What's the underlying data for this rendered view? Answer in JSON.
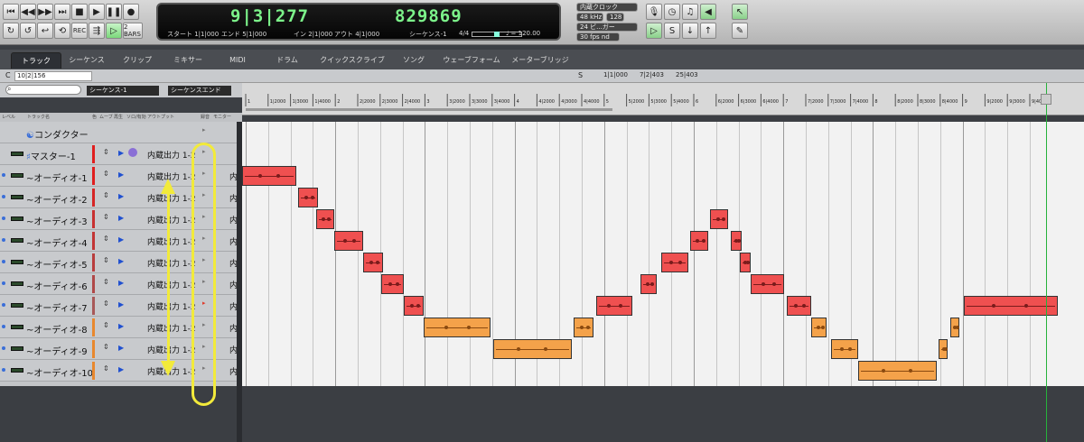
{
  "transport": {
    "buttons": [
      "go-to-start-icon",
      "rewind-icon",
      "fast-forward-icon",
      "go-to-end-icon",
      "stop-icon",
      "play-icon",
      "pause-icon",
      "record-icon"
    ],
    "rec_label": "REC",
    "bars_label": "2 BARS",
    "time_primary": "9|3|277",
    "time_samples": "829869",
    "start_text": "スタート 1|1|000",
    "end_text": "エンド 5|1|000",
    "in_text": "イン 2|1|000",
    "out_text": "アウト 4|1|000",
    "sequence_text": "シーケンス-1",
    "time_sig": "4/4",
    "tempo_text": "♩ = 120.00",
    "clock_source": "内蔵クロック",
    "sample_rate": "48 kHz",
    "buffer": "128",
    "bit_depth": "24 ビ...ガー",
    "fps": "30 fps nd"
  },
  "tabs": [
    {
      "label": "トラック",
      "active": true
    },
    {
      "label": "シーケンス",
      "active": false
    },
    {
      "label": "クリップ",
      "active": false
    },
    {
      "label": "ミキサー",
      "active": false
    },
    {
      "label": "MIDI",
      "active": false
    },
    {
      "label": "ドラム",
      "active": false
    },
    {
      "label": "クイックスクライブ",
      "active": false
    },
    {
      "label": "ソング",
      "active": false
    },
    {
      "label": "ウェーブフォーム",
      "active": false
    },
    {
      "label": "メーターブリッジ",
      "active": false
    }
  ],
  "subheader": {
    "left_label": "C",
    "position": "10|2|156",
    "s_label": "S",
    "range_start": "1|1|000",
    "range_mid": "7|2|403",
    "range_end": "25|403"
  },
  "search": {
    "placeholder": "",
    "sequence_dd": "シーケンス-1",
    "end_dd": "シーケンスエンド"
  },
  "track_columns": [
    "レベル",
    "トラック名",
    "色",
    "ムーブ",
    "再生",
    "ソロ/有効",
    "アウトプット",
    "録音",
    "モニター"
  ],
  "tracks": [
    {
      "name": "コンダクター",
      "icon": "☯",
      "color": "",
      "output": "",
      "input": "",
      "type": "conductor"
    },
    {
      "name": "マスター-1",
      "icon": "♯",
      "color": "#e01e1e",
      "output": "内蔵出力 1-2",
      "input": "",
      "type": "master"
    },
    {
      "name": "~オーディオ-1",
      "color": "#e01e1e",
      "output": "内蔵出力 1-2",
      "input": "内",
      "type": "audio"
    },
    {
      "name": "~オーディオ-2",
      "color": "#d62525",
      "output": "内蔵出力 1-2",
      "input": "内",
      "type": "audio"
    },
    {
      "name": "~オーディオ-3",
      "color": "#c83030",
      "output": "内蔵出力 1-2",
      "input": "内",
      "type": "audio"
    },
    {
      "name": "~オーディオ-4",
      "color": "#c23535",
      "output": "内蔵出力 1-2",
      "input": "内",
      "type": "audio"
    },
    {
      "name": "~オーディオ-5",
      "color": "#b83d3d",
      "output": "内蔵出力 1-2",
      "input": "内",
      "type": "audio"
    },
    {
      "name": "~オーディオ-6",
      "color": "#b04848",
      "output": "内蔵出力 1-2",
      "input": "内",
      "type": "audio"
    },
    {
      "name": "~オーディオ-7",
      "color": "#a85858",
      "output": "内蔵出力 1-2",
      "input": "内",
      "type": "audio"
    },
    {
      "name": "~オーディオ-8",
      "color": "#e8882e",
      "output": "内蔵出力 1-2",
      "input": "内",
      "type": "audio"
    },
    {
      "name": "~オーディオ-9",
      "color": "#e8882e",
      "output": "内蔵出力 1-2",
      "input": "内",
      "type": "audio"
    },
    {
      "name": "~オーディオ-10",
      "color": "#e8882e",
      "output": "内蔵出力 1-2",
      "input": "内",
      "type": "audio"
    }
  ],
  "ruler_labels": [
    "1",
    "1|2000",
    "1|3000",
    "1|4000",
    "2",
    "2|2000",
    "2|3000",
    "2|4000",
    "3",
    "3|2000",
    "3|3000",
    "3|4000",
    "4",
    "4|2000",
    "4|3000",
    "4|4000",
    "5",
    "5|2000",
    "5|3000",
    "5|4000",
    "6",
    "6|2000",
    "6|3000",
    "6|4000",
    "7",
    "7|2000",
    "7|3000",
    "7|4000",
    "8",
    "8|2000",
    "8|3000",
    "8|4000",
    "9",
    "9|2000",
    "9|3000",
    "9|4000"
  ],
  "colors": {
    "red_clip": "#ef5050",
    "orange_clip": "#f4a24a",
    "playhead": "#26b23b",
    "annotation": "#f2ea3b"
  }
}
